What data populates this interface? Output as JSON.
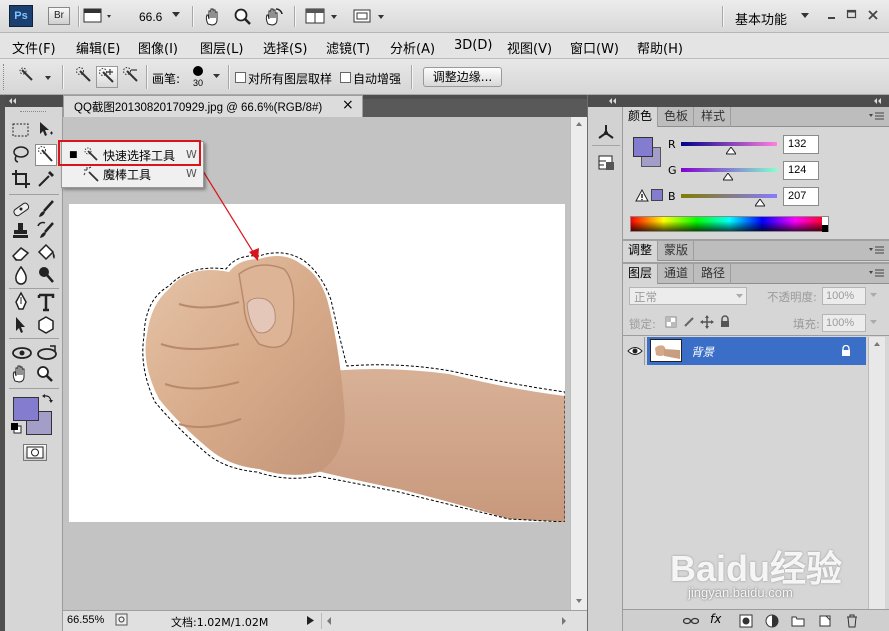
{
  "app": {
    "logo_text": "Ps",
    "bridge_text": "Br",
    "zoom_value": "66.6",
    "workspace": "基本功能"
  },
  "menu": [
    "文件(F)",
    "编辑(E)",
    "图像(I)",
    "图层(L)",
    "选择(S)",
    "滤镜(T)",
    "分析(A)",
    "3D(D)",
    "视图(V)",
    "窗口(W)",
    "帮助(H)"
  ],
  "options_bar": {
    "brush_label": "画笔:",
    "brush_size": "30",
    "sample_all_layers": "对所有图层取样",
    "auto_enhance": "自动增强",
    "refine_edge_button": "调整边缘..."
  },
  "document": {
    "tab_title": "QQ截图20130820170929.jpg @ 66.6%(RGB/8#)",
    "close_glyph": "×",
    "zoom_status": "66.55%",
    "doc_info": "文档:1.02M/1.02M"
  },
  "flyout": {
    "items": [
      {
        "label": "快速选择工具",
        "shortcut": "W",
        "selected": true
      },
      {
        "label": "魔棒工具",
        "shortcut": "W",
        "selected": false
      }
    ]
  },
  "color_panel": {
    "tabs": [
      "颜色",
      "色板",
      "样式"
    ],
    "channels": [
      {
        "label": "R",
        "value": "132"
      },
      {
        "label": "G",
        "value": "124"
      },
      {
        "label": "B",
        "value": "207"
      }
    ],
    "foreground_color": "#847ccf",
    "background_color": "#a39ec7"
  },
  "adjust_panel": {
    "tabs": [
      "调整",
      "蒙版"
    ]
  },
  "layers_panel": {
    "tabs": [
      "图层",
      "通道",
      "路径"
    ],
    "blend_mode": "正常",
    "opacity_label": "不透明度:",
    "opacity_value": "100%",
    "lock_label": "锁定:",
    "fill_label": "填充:",
    "fill_value": "100%",
    "layer_name": "背景"
  },
  "watermark": {
    "brand": "Baidu经验",
    "url": "jingyan.baidu.com"
  },
  "colors": {
    "selection_highlight": "#d9151b",
    "layer_selected": "#3a6ec7"
  }
}
